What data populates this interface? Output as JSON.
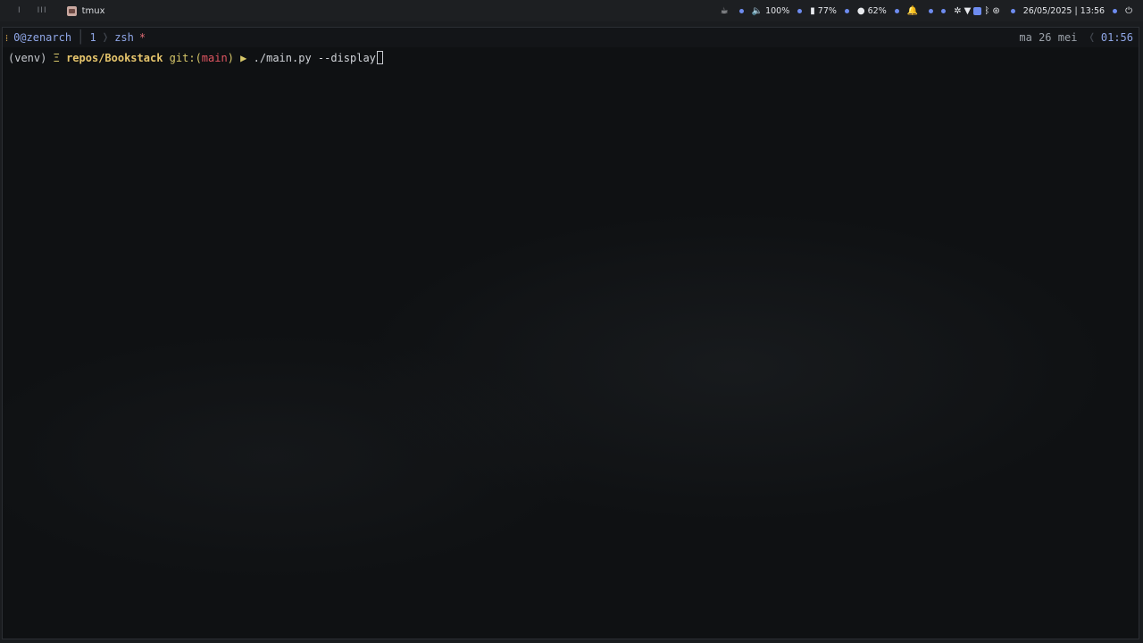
{
  "topbar": {
    "workspace_1": "I",
    "workspace_2": "III",
    "app_title": "tmux",
    "volume": "100%",
    "battery": "77%",
    "brightness": "62%",
    "datetime": "26/05/2025 | 13:56"
  },
  "tmux": {
    "session": "0@zenarch",
    "window_index": "1",
    "window_name": "zsh",
    "window_flag": "*",
    "date": "ma 26 mei",
    "time": "01:56"
  },
  "prompt": {
    "venv": "(venv)",
    "menu_glyph": "Ξ",
    "path": "repos/Bookstack",
    "git_label": "git:(",
    "branch": "main",
    "git_close": ")",
    "arrow": "▶",
    "command": "./main.py --display"
  },
  "colors": {
    "accent": "#8fa6e6",
    "path": "#e6c56c",
    "branch": "#e05561",
    "background": "#0f1113"
  }
}
